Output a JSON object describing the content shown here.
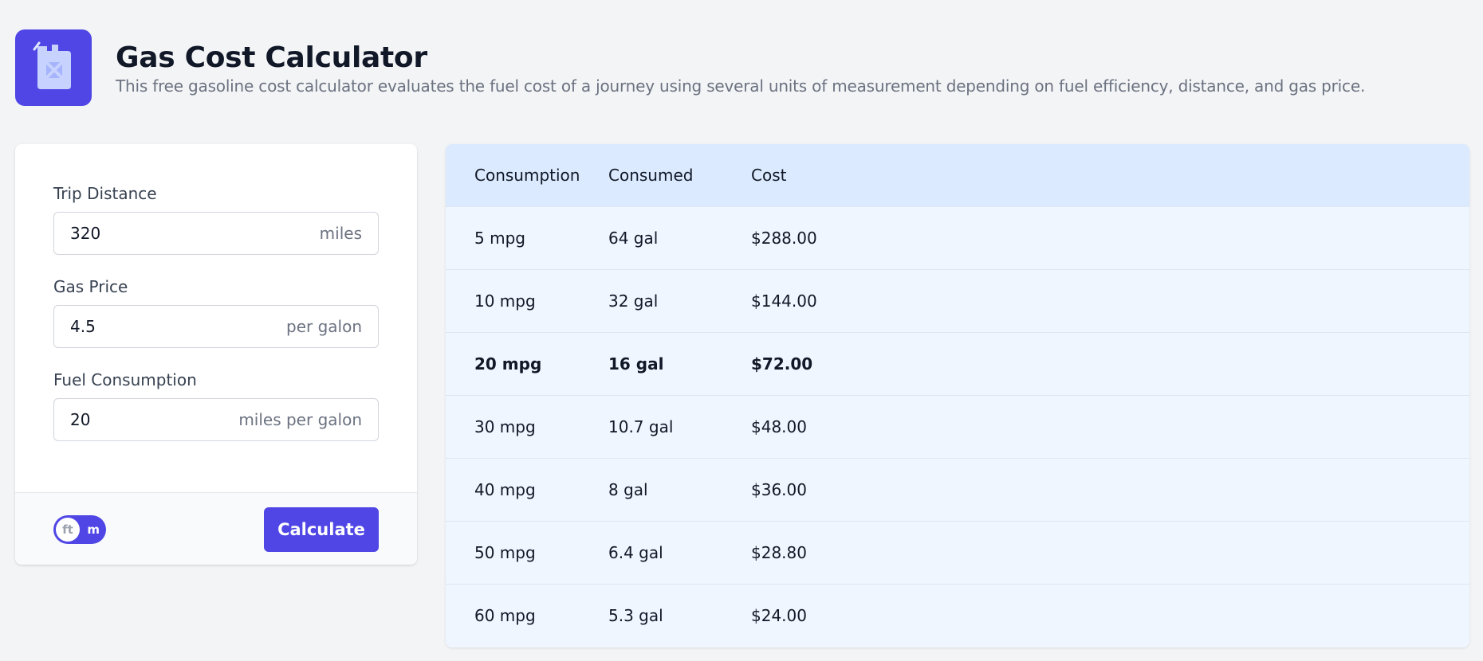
{
  "header": {
    "title": "Gas Cost Calculator",
    "subtitle": "This free gasoline cost calculator evaluates the fuel cost of a journey using several units of measurement depending on fuel efficiency, distance, and gas price.",
    "logo_icon": "fuel-can-icon"
  },
  "form": {
    "fields": [
      {
        "label": "Trip Distance",
        "value": "320",
        "unit": "miles"
      },
      {
        "label": "Gas Price",
        "value": "4.5",
        "unit": "per galon"
      },
      {
        "label": "Fuel Consumption",
        "value": "20",
        "unit": "miles per galon"
      }
    ],
    "unit_toggle": {
      "selected": "ft",
      "alternate": "m"
    },
    "calculate_label": "Calculate"
  },
  "results": {
    "columns": [
      "Consumption",
      "Consumed",
      "Cost"
    ],
    "rows": [
      {
        "consumption": "5 mpg",
        "consumed": "64 gal",
        "cost": "$288.00",
        "highlight": false
      },
      {
        "consumption": "10 mpg",
        "consumed": "32 gal",
        "cost": "$144.00",
        "highlight": false
      },
      {
        "consumption": "20 mpg",
        "consumed": "16 gal",
        "cost": "$72.00",
        "highlight": true
      },
      {
        "consumption": "30 mpg",
        "consumed": "10.7 gal",
        "cost": "$48.00",
        "highlight": false
      },
      {
        "consumption": "40 mpg",
        "consumed": "8 gal",
        "cost": "$36.00",
        "highlight": false
      },
      {
        "consumption": "50 mpg",
        "consumed": "6.4 gal",
        "cost": "$28.80",
        "highlight": false
      },
      {
        "consumption": "60 mpg",
        "consumed": "5.3 gal",
        "cost": "$24.00",
        "highlight": false
      }
    ]
  },
  "colors": {
    "accent": "#4f46e5",
    "header_row": "#dbeafe",
    "table_bg": "#eff6ff",
    "page_bg": "#f3f4f6"
  }
}
